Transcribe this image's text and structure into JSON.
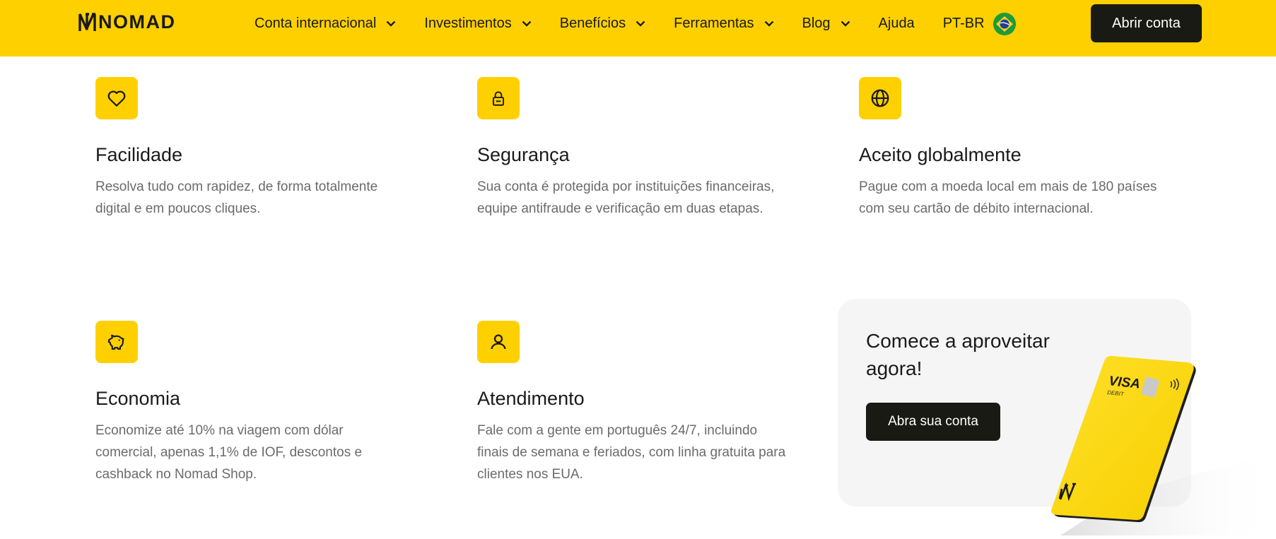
{
  "header": {
    "logo_text": "NOMAD",
    "nav": [
      {
        "label": "Conta internacional",
        "icon": "chevron-down-icon"
      },
      {
        "label": "Investimentos",
        "icon": "chevron-down-icon"
      },
      {
        "label": "Benefícios",
        "icon": "chevron-down-icon"
      },
      {
        "label": "Ferramentas",
        "icon": "chevron-down-icon"
      },
      {
        "label": "Blog",
        "icon": "chevron-down-icon"
      },
      {
        "label": "Ajuda"
      }
    ],
    "language": {
      "label": "PT-BR",
      "icon": "brazil-flag-icon"
    },
    "cta_label": "Abrir conta"
  },
  "features": [
    {
      "icon": "heart-icon",
      "title": "Facilidade",
      "description": "Resolva tudo com rapidez, de forma totalmente digital e em poucos cliques."
    },
    {
      "icon": "lock-icon",
      "title": "Segurança",
      "description": "Sua conta é protegida por instituições financeiras, equipe antifraude e verificação em duas etapas."
    },
    {
      "icon": "globe-icon",
      "title": "Aceito globalmente",
      "description": "Pague com a moeda local em mais de 180 países com seu cartão de débito internacional."
    },
    {
      "icon": "piggy-bank-icon",
      "title": "Economia",
      "description": "Economize até 10% na viagem com dólar comercial, apenas 1,1% de IOF, descontos e cashback no Nomad Shop."
    },
    {
      "icon": "user-icon",
      "title": "Atendimento",
      "description": "Fale com a gente em  português 24/7, incluindo finais de semana e feriados, com linha gratuita para clientes nos EUA."
    }
  ],
  "promo": {
    "title": "Comece a aproveitar agora!",
    "button_label": "Abra sua conta",
    "card": {
      "brand": "VISA",
      "subtitle": "DEBIT"
    }
  },
  "colors": {
    "brand_yellow": "#ffd000",
    "dark": "#1a1a14",
    "muted_text": "#6b6b6b",
    "promo_bg": "#f5f5f5"
  }
}
